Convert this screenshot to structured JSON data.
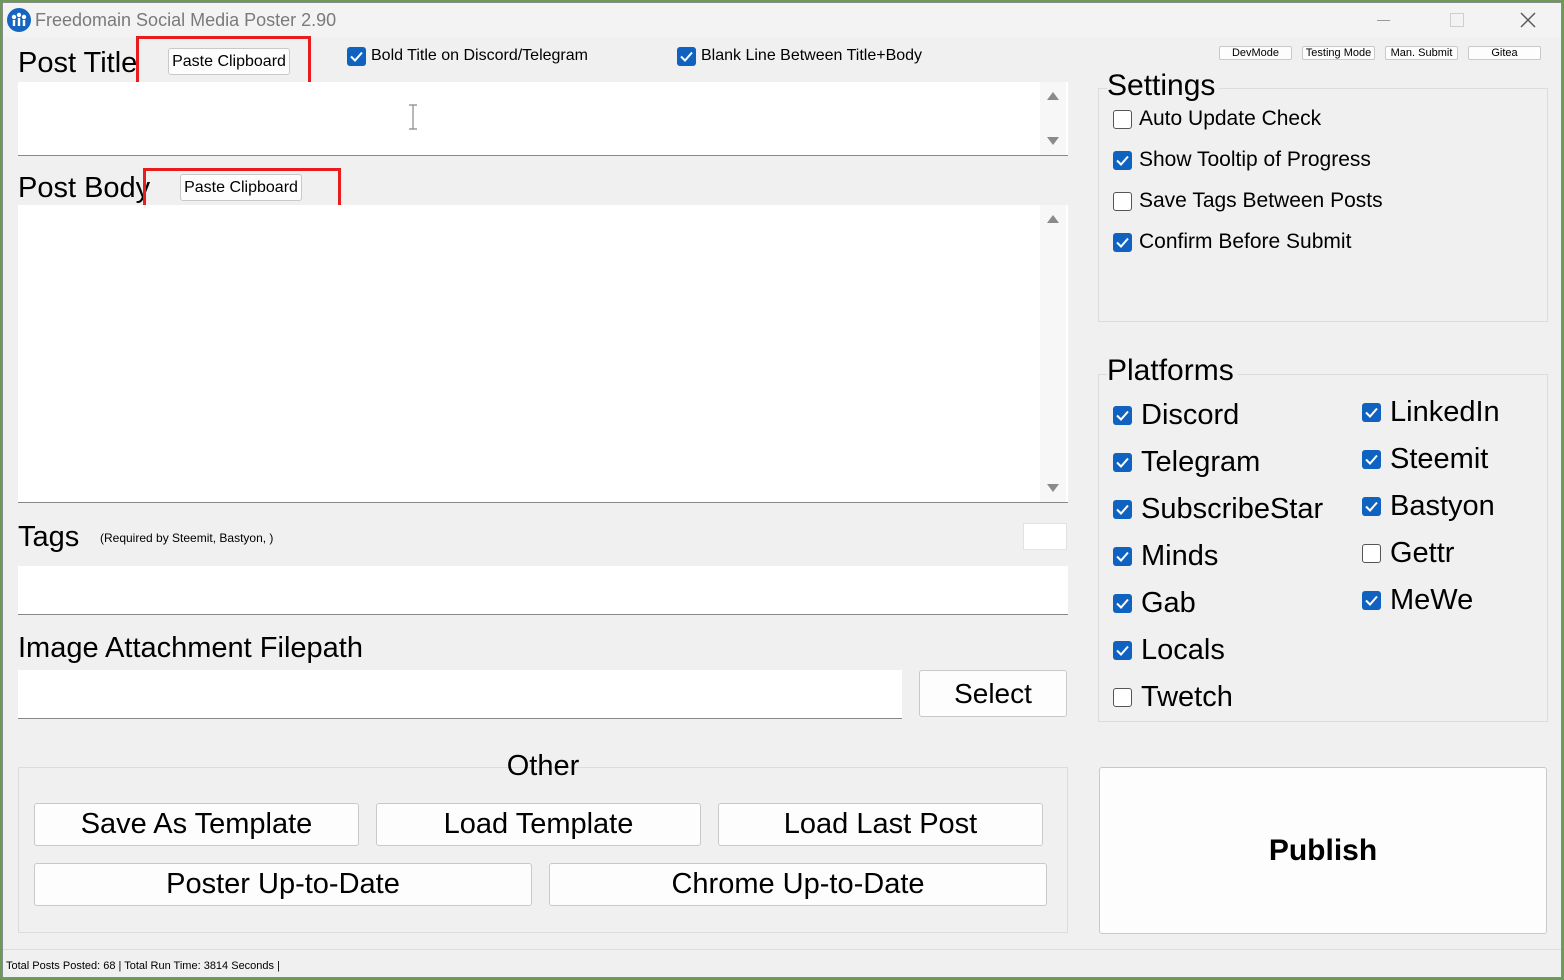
{
  "window": {
    "title": "Freedomain Social Media Poster 2.90"
  },
  "post_title": {
    "label": "Post Title",
    "paste_button": "Paste Clipboard",
    "value": ""
  },
  "options": {
    "bold_title": {
      "label": "Bold Title on Discord/Telegram",
      "checked": true
    },
    "blank_line": {
      "label": "Blank Line Between Title+Body",
      "checked": true
    }
  },
  "top_buttons": {
    "devmode": "DevMode",
    "testing_mode": "Testing Mode",
    "man_submit": "Man. Submit",
    "gitea": "Gitea"
  },
  "post_body": {
    "label": "Post Body",
    "paste_button": "Paste Clipboard",
    "value": ""
  },
  "tags": {
    "label": "Tags",
    "note": "(Required by Steemit, Bastyon, )",
    "value": ""
  },
  "image": {
    "label": "Image Attachment Filepath",
    "value": "",
    "select_button": "Select"
  },
  "other": {
    "label": "Other",
    "save_template": "Save As Template",
    "load_template": "Load Template",
    "load_last_post": "Load Last Post",
    "poster_up_to_date": "Poster Up-to-Date",
    "chrome_up_to_date": "Chrome Up-to-Date"
  },
  "settings": {
    "label": "Settings",
    "items": [
      {
        "label": "Auto Update Check",
        "checked": false
      },
      {
        "label": "Show Tooltip of Progress",
        "checked": true
      },
      {
        "label": "Save Tags Between Posts",
        "checked": false
      },
      {
        "label": "Confirm Before Submit",
        "checked": true
      }
    ]
  },
  "platforms": {
    "label": "Platforms",
    "left": [
      {
        "label": "Discord",
        "checked": true
      },
      {
        "label": "Telegram",
        "checked": true
      },
      {
        "label": "SubscribeStar",
        "checked": true
      },
      {
        "label": "Minds",
        "checked": true
      },
      {
        "label": "Gab",
        "checked": true
      },
      {
        "label": "Locals",
        "checked": true
      },
      {
        "label": "Twetch",
        "checked": false
      }
    ],
    "right": [
      {
        "label": "LinkedIn",
        "checked": true
      },
      {
        "label": "Steemit",
        "checked": true
      },
      {
        "label": "Bastyon",
        "checked": true
      },
      {
        "label": "Gettr",
        "checked": false
      },
      {
        "label": "MeWe",
        "checked": true
      }
    ]
  },
  "publish_button": "Publish",
  "status": "Total Posts Posted: 68 | Total Run Time: 3814 Seconds |",
  "colors": {
    "accent": "#0f62c0",
    "highlight": "#e81c1c",
    "window_bg": "#f0f0f0"
  }
}
